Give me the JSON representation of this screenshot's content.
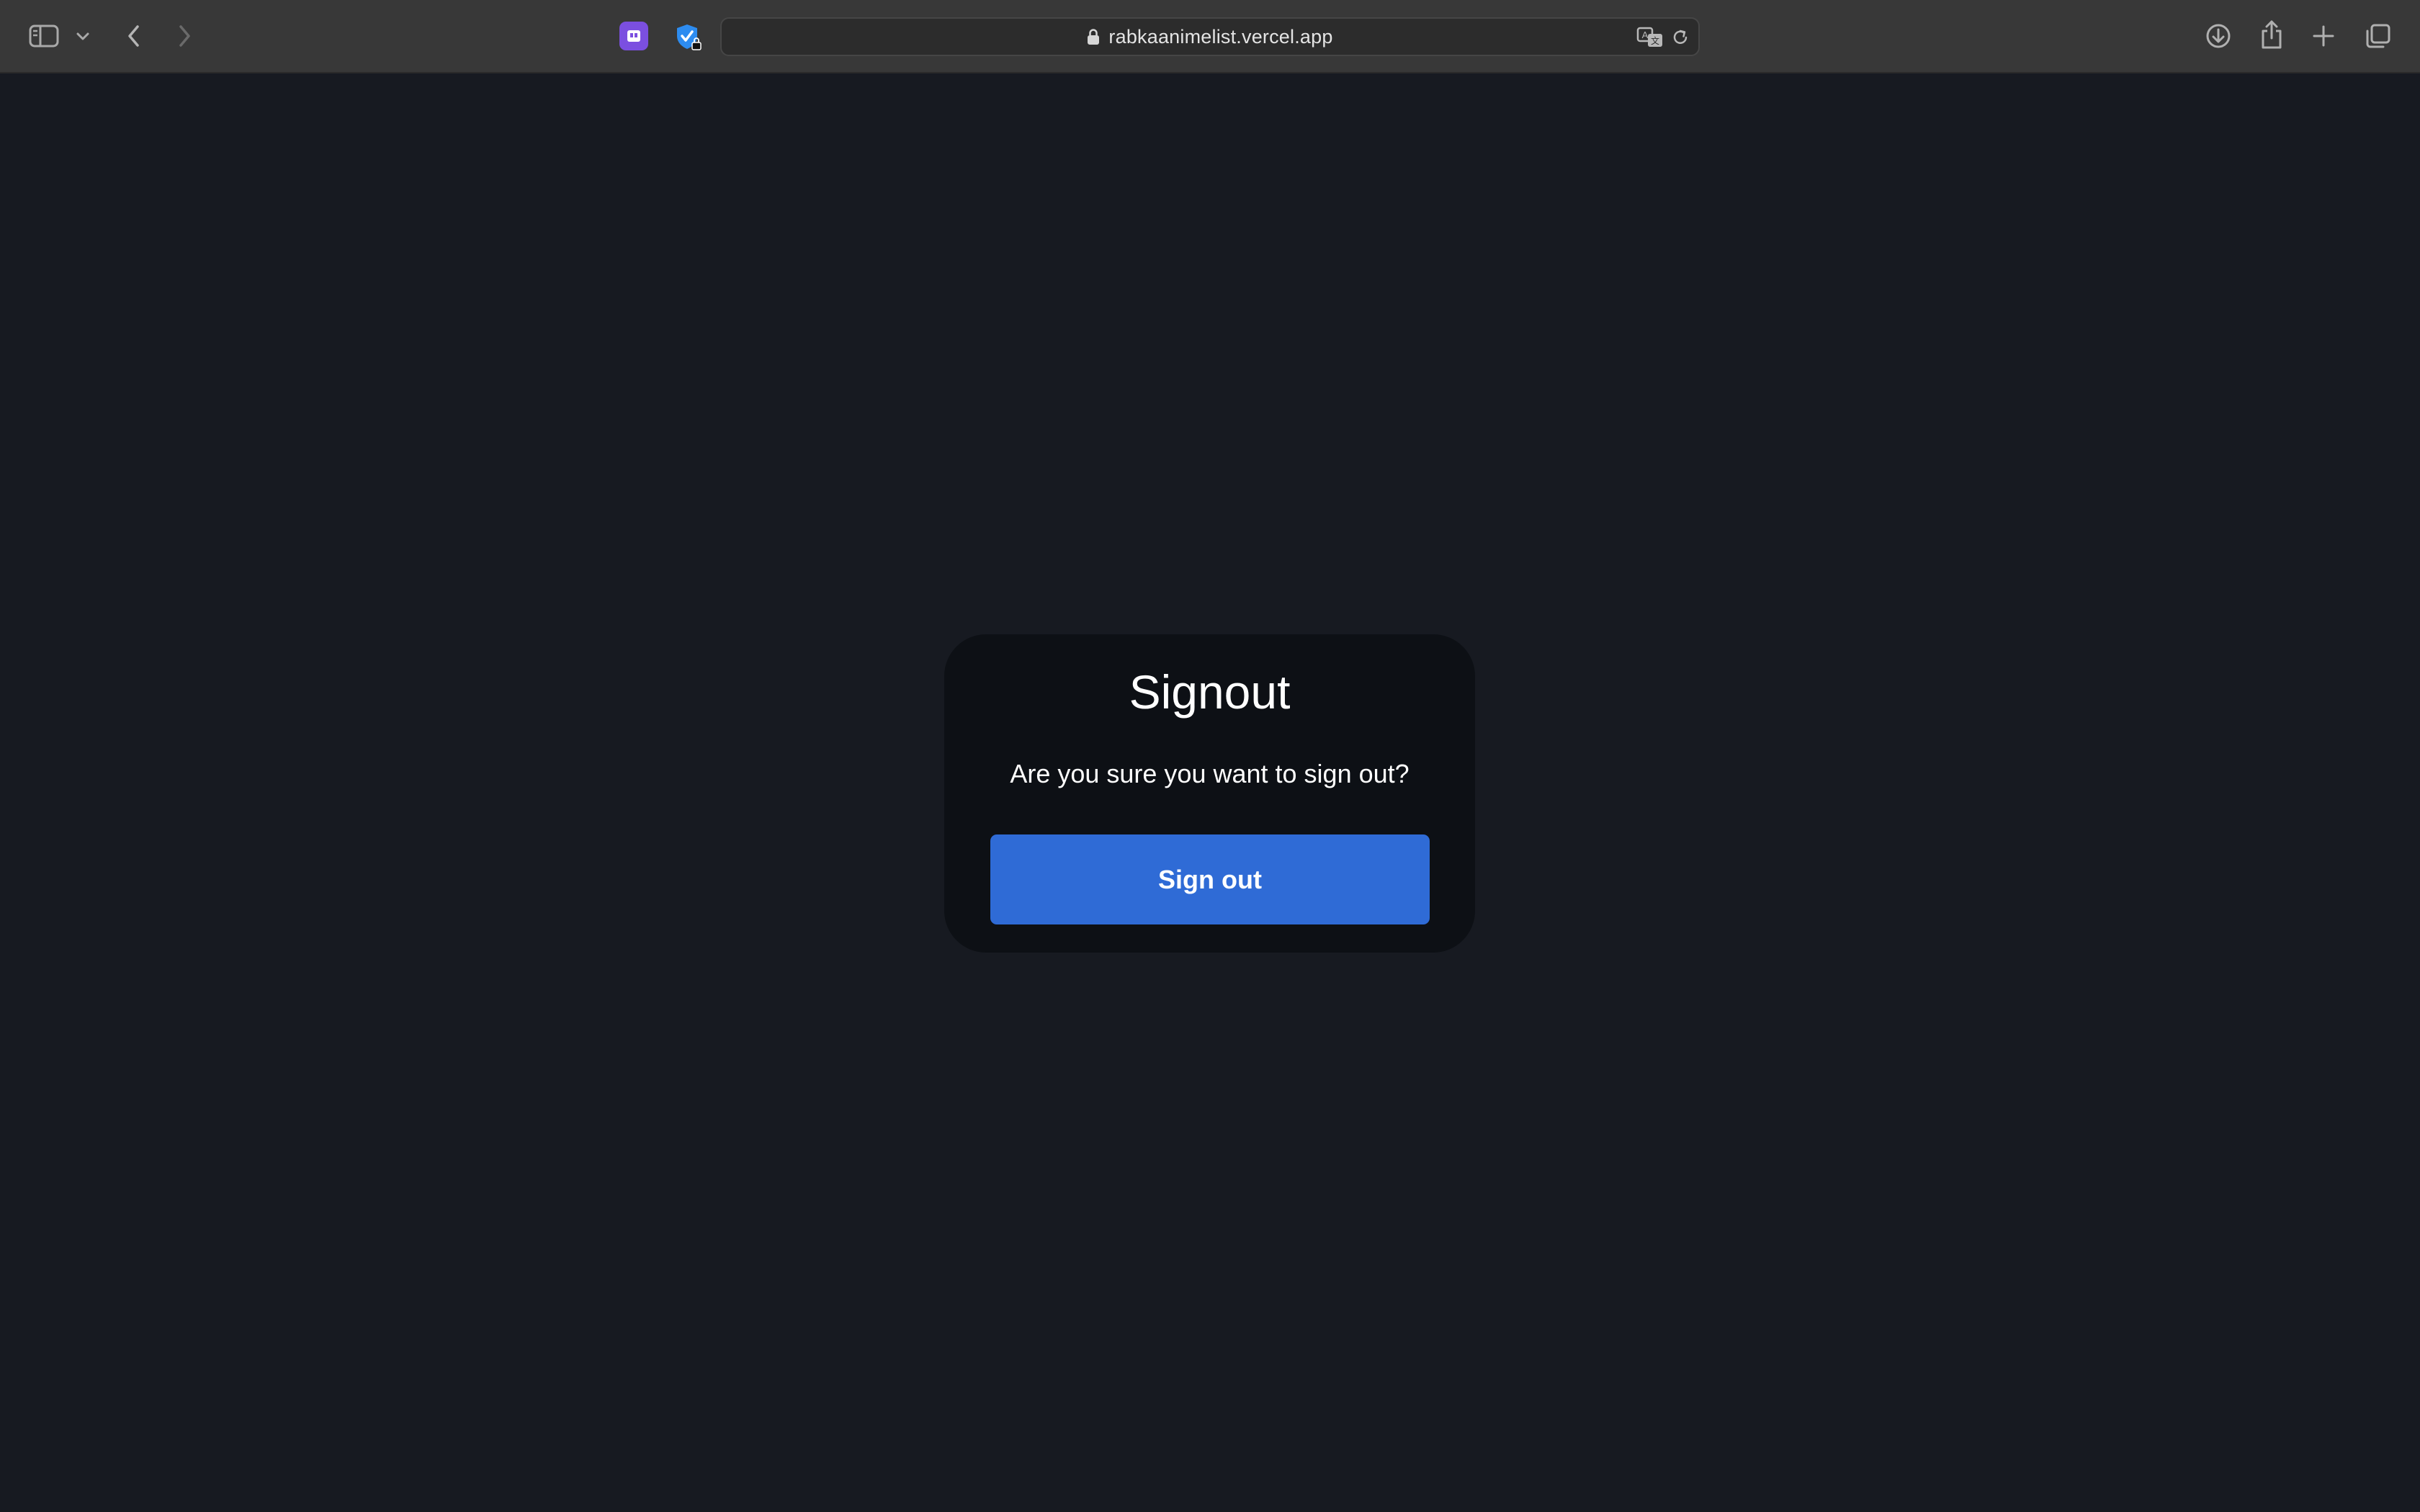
{
  "browser": {
    "url": "rabkaanimelist.vercel.app",
    "icons": {
      "sidebar": "sidebar-icon",
      "sidebar_menu": "chevron-down-icon",
      "back": "chevron-left-icon",
      "forward": "chevron-right-icon",
      "extension_1": "purple-extension-icon",
      "extension_2": "shield-check-icon",
      "lock": "lock-icon",
      "translate": "translate-icon",
      "reload": "reload-icon",
      "downloads": "download-icon",
      "share": "share-icon",
      "new_tab": "plus-icon",
      "tab_overview": "tabs-icon"
    },
    "colors": {
      "toolbar": "#383838",
      "address_bar": "#2c2c2c"
    }
  },
  "page": {
    "title": "Signout",
    "message": "Are you sure you want to sign out?",
    "button_label": "Sign out",
    "colors": {
      "background": "#171a21",
      "card": "#0d1015",
      "button": "#2f6bd6"
    }
  }
}
